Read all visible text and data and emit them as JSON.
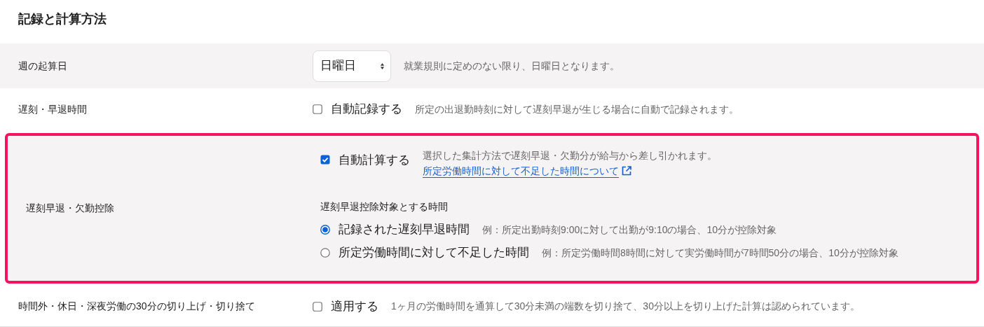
{
  "title": "記録と計算方法",
  "rows": [
    {
      "kind": "select",
      "label": "週の起算日",
      "highlighted": false,
      "value": "日曜日",
      "note": "就業規則に定めのない限り、日曜日となります。"
    },
    {
      "kind": "checkbox",
      "label": "遅刻・早退時間",
      "highlighted": false,
      "checkbox": {
        "label": "自動記録する",
        "checked": false
      },
      "note": "所定の出退勤時刻に対して遅刻早退が生じる場合に自動で記録されます。"
    },
    {
      "kind": "checkbox_radio",
      "label": "遅刻早退・欠勤控除",
      "highlighted": true,
      "checkbox": {
        "label": "自動計算する",
        "checked": true
      },
      "note": "選択した集計方法で遅刻早退・欠勤分が給与から差し引かれます。",
      "link": "所定労働時間に対して不足した時間について",
      "subheading": "遅刻早退控除対象とする時間",
      "options": [
        {
          "label": "記録された遅刻早退時間",
          "example": "例：所定出勤時刻9:00に対して出勤が9:10の場合、10分が控除対象",
          "selected": true
        },
        {
          "label": "所定労働時間に対して不足した時間",
          "example": "例：所定労働時間8時間に対して実労働時間が7時間50分の場合、10分が控除対象",
          "selected": false
        }
      ]
    },
    {
      "kind": "checkbox",
      "label": "時間外・休日・深夜労働の30分の切り上げ・切り捨て",
      "highlighted": false,
      "checkbox": {
        "label": "適用する",
        "checked": false
      },
      "note": "1ヶ月の労働時間を通算して30分未満の端数を切り捨て、30分以上を切り上げた計算は認められています。"
    }
  ]
}
